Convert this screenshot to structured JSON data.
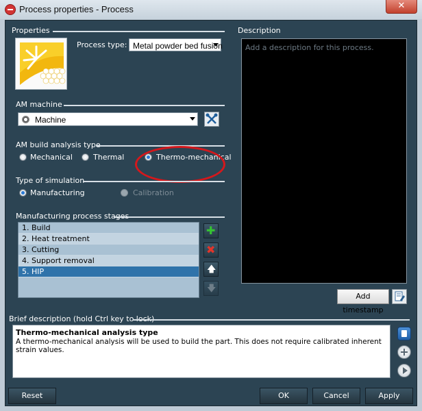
{
  "window": {
    "title": "Process properties - Process",
    "close_glyph": "✕"
  },
  "properties": {
    "section_label": "Properties",
    "process_type_label": "Process type:",
    "process_type_value": "Metal powder bed fusion",
    "icon": "metal-powder-bed-fusion-icon"
  },
  "description": {
    "section_label": "Description",
    "placeholder": "Add a description for this process.",
    "add_timestamp_label": "Add timestamp"
  },
  "am_machine": {
    "section_label": "AM machine",
    "value": "Machine"
  },
  "analysis_type": {
    "section_label": "AM build analysis type",
    "options": [
      {
        "label": "Mechanical",
        "selected": false
      },
      {
        "label": "Thermal",
        "selected": false
      },
      {
        "label": "Thermo-mechanical",
        "selected": true
      }
    ]
  },
  "simulation": {
    "section_label": "Type of simulation",
    "options": [
      {
        "label": "Manufacturing",
        "selected": true,
        "enabled": true
      },
      {
        "label": "Calibration",
        "selected": false,
        "enabled": false
      }
    ]
  },
  "stages": {
    "section_label": "Manufacturing process stages",
    "items": [
      {
        "label": "1.  Build"
      },
      {
        "label": "2.  Heat treatment"
      },
      {
        "label": "3.  Cutting"
      },
      {
        "label": "4.  Support removal"
      },
      {
        "label": "5.  HIP",
        "selected": true
      }
    ],
    "buttons": {
      "add_glyph": "✚",
      "delete_glyph": "✖",
      "up_glyph": "🡅",
      "down_glyph": "🡇"
    }
  },
  "brief": {
    "section_label": "Brief description (hold Ctrl key to lock)",
    "title": "Thermo-mechanical analysis type",
    "body": "A thermo-mechanical analysis will be used to build the part. This does not require calibrated inherent strain values."
  },
  "footer": {
    "reset_label": "Reset",
    "ok_label": "OK",
    "cancel_label": "Cancel",
    "apply_label": "Apply"
  },
  "colors": {
    "highlight": "#d4181c",
    "accent": "#2f73aa",
    "panel": "#2c4453"
  }
}
